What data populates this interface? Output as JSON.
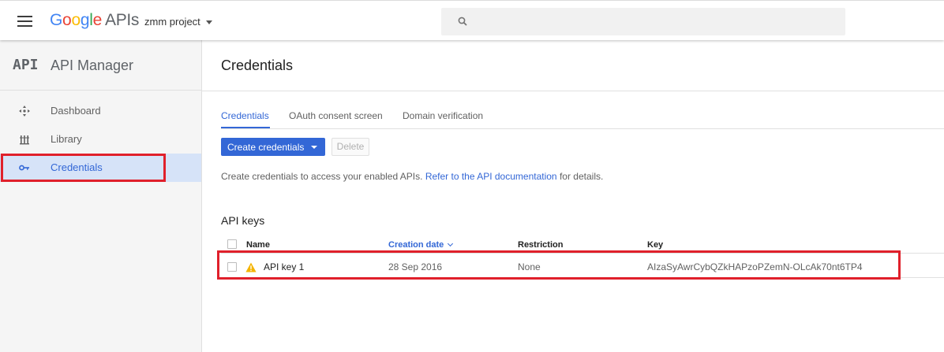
{
  "topbar": {
    "logo": {
      "g": "G",
      "o1": "o",
      "o2": "o",
      "g2": "g",
      "l": "l",
      "e": "e",
      "apis": "APIs"
    },
    "project": "zmm project",
    "search_placeholder": ""
  },
  "sidebar": {
    "logo_text": "API",
    "title": "API Manager",
    "items": [
      {
        "label": "Dashboard",
        "icon": "dashboard-icon"
      },
      {
        "label": "Library",
        "icon": "library-icon"
      },
      {
        "label": "Credentials",
        "icon": "key-icon",
        "active": true
      }
    ]
  },
  "main": {
    "title": "Credentials",
    "tabs": [
      {
        "label": "Credentials",
        "active": true
      },
      {
        "label": "OAuth consent screen"
      },
      {
        "label": "Domain verification"
      }
    ],
    "create_button": "Create credentials",
    "delete_button": "Delete",
    "description": {
      "prefix": "Create credentials to access your enabled APIs.",
      "link": "Refer to the API documentation",
      "suffix": "for details."
    },
    "api_keys": {
      "title": "API keys",
      "columns": {
        "name": "Name",
        "creation_date": "Creation date",
        "restriction": "Restriction",
        "key": "Key"
      },
      "rows": [
        {
          "name": "API key 1",
          "creation_date": "28 Sep 2016",
          "restriction": "None",
          "key": "AIzaSyAwrCybQZkHAPzoPZemN-OLcAk70nt6TP4"
        }
      ]
    }
  },
  "colors": {
    "accent": "#3367d6",
    "highlight": "#e0202b",
    "warning": "#f4b400"
  }
}
